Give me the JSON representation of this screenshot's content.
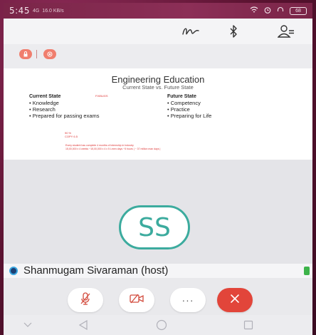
{
  "status_bar": {
    "time": "5:45",
    "network": "4G",
    "speed": "16.0 KB/s",
    "battery": "68"
  },
  "toolbar": {
    "icons": [
      "scribble-icon",
      "bluetooth-icon",
      "participants-icon"
    ]
  },
  "badges": {
    "colors": {
      "badge": "#f07e6e"
    }
  },
  "slide": {
    "title": "Engineering Education",
    "subtitle": "Current State vs. Future State",
    "current_state": {
      "heading": "Current State",
      "items": [
        "Knowledge",
        "Research",
        "Prepared for passing exams"
      ]
    },
    "future_state": {
      "heading": "Future State",
      "items": [
        "Competency",
        "Practice",
        "Preparing for Life"
      ]
    },
    "annotation_top": "FIXBUGS",
    "annotation_mid_1": "90 %",
    "annotation_mid_2": "COPY 6.5",
    "annotation_bottom_1": "Every student has complete 4 months of internship in Industry",
    "annotation_bottom_2": "15,00,000 x 4 weeks ~15,00,000 x 4 x 5 Lmen days ~5 hours | ~ 37 million man days |"
  },
  "video": {
    "initials": "SS",
    "accent": "#3cab9e"
  },
  "participant": {
    "name": "Shanmugam Sivaraman (host)"
  },
  "controls": {
    "end_color": "#e2453a",
    "more_label": "···"
  }
}
